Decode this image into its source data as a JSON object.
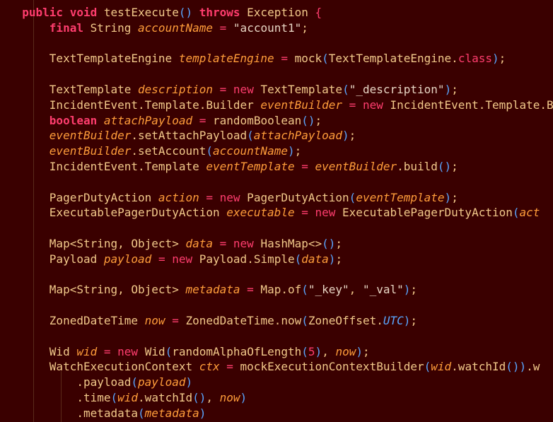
{
  "editor": {
    "lines": [
      [
        [
          "  ",
          "fn"
        ],
        [
          "public",
          "kw"
        ],
        [
          " ",
          "fn"
        ],
        [
          "void",
          "kw"
        ],
        [
          " testExecute",
          "fn"
        ],
        [
          "()",
          "br"
        ],
        [
          " ",
          "fn"
        ],
        [
          "throws",
          "kw"
        ],
        [
          " Exception ",
          "fn"
        ],
        [
          "{",
          "op"
        ]
      ],
      [
        [
          "      ",
          "fn"
        ],
        [
          "final",
          "kw"
        ],
        [
          " String ",
          "ty"
        ],
        [
          "accountName",
          "var"
        ],
        [
          " ",
          "fn"
        ],
        [
          "=",
          "op"
        ],
        [
          " ",
          "fn"
        ],
        [
          "\"account1\"",
          "str"
        ],
        [
          ";",
          "fn"
        ]
      ],
      [],
      [
        [
          "      TextTemplateEngine ",
          "ty"
        ],
        [
          "templateEngine",
          "var"
        ],
        [
          " ",
          "fn"
        ],
        [
          "=",
          "op"
        ],
        [
          " mock",
          "fn"
        ],
        [
          "(",
          "br"
        ],
        [
          "TextTemplateEngine.",
          "ty"
        ],
        [
          "class",
          "op"
        ],
        [
          ")",
          "br"
        ],
        [
          ";",
          "fn"
        ]
      ],
      [],
      [
        [
          "      TextTemplate ",
          "ty"
        ],
        [
          "description",
          "var"
        ],
        [
          " ",
          "fn"
        ],
        [
          "=",
          "op"
        ],
        [
          " ",
          "fn"
        ],
        [
          "new",
          "op"
        ],
        [
          " TextTemplate",
          "ty"
        ],
        [
          "(",
          "br"
        ],
        [
          "\"_description\"",
          "str"
        ],
        [
          ")",
          "br"
        ],
        [
          ";",
          "fn"
        ]
      ],
      [
        [
          "      IncidentEvent.Template.Builder ",
          "ty"
        ],
        [
          "eventBuilder",
          "var"
        ],
        [
          " ",
          "fn"
        ],
        [
          "=",
          "op"
        ],
        [
          " ",
          "fn"
        ],
        [
          "new",
          "op"
        ],
        [
          " IncidentEvent.Template.Builder(",
          "ty"
        ]
      ],
      [
        [
          "      ",
          "fn"
        ],
        [
          "boolean",
          "kw"
        ],
        [
          " ",
          "fn"
        ],
        [
          "attachPayload",
          "var"
        ],
        [
          " ",
          "fn"
        ],
        [
          "=",
          "op"
        ],
        [
          " randomBoolean",
          "fn"
        ],
        [
          "()",
          "br"
        ],
        [
          ";",
          "fn"
        ]
      ],
      [
        [
          "      ",
          "fn"
        ],
        [
          "eventBuilder",
          "var"
        ],
        [
          ".setAttachPayload",
          "fn"
        ],
        [
          "(",
          "br"
        ],
        [
          "attachPayload",
          "var"
        ],
        [
          ")",
          "br"
        ],
        [
          ";",
          "fn"
        ]
      ],
      [
        [
          "      ",
          "fn"
        ],
        [
          "eventBuilder",
          "var"
        ],
        [
          ".setAccount",
          "fn"
        ],
        [
          "(",
          "br"
        ],
        [
          "accountName",
          "var"
        ],
        [
          ")",
          "br"
        ],
        [
          ";",
          "fn"
        ]
      ],
      [
        [
          "      IncidentEvent.Template ",
          "ty"
        ],
        [
          "eventTemplate",
          "var"
        ],
        [
          " ",
          "fn"
        ],
        [
          "=",
          "op"
        ],
        [
          " ",
          "fn"
        ],
        [
          "eventBuilder",
          "var"
        ],
        [
          ".build",
          "fn"
        ],
        [
          "()",
          "br"
        ],
        [
          ";",
          "fn"
        ]
      ],
      [],
      [
        [
          "      PagerDutyAction ",
          "ty"
        ],
        [
          "action",
          "var"
        ],
        [
          " ",
          "fn"
        ],
        [
          "=",
          "op"
        ],
        [
          " ",
          "fn"
        ],
        [
          "new",
          "op"
        ],
        [
          " PagerDutyAction",
          "ty"
        ],
        [
          "(",
          "br"
        ],
        [
          "eventTemplate",
          "var"
        ],
        [
          ")",
          "br"
        ],
        [
          ";",
          "fn"
        ]
      ],
      [
        [
          "      ExecutablePagerDutyAction ",
          "ty"
        ],
        [
          "executable",
          "var"
        ],
        [
          " ",
          "fn"
        ],
        [
          "=",
          "op"
        ],
        [
          " ",
          "fn"
        ],
        [
          "new",
          "op"
        ],
        [
          " ExecutablePagerDutyAction",
          "ty"
        ],
        [
          "(",
          "br"
        ],
        [
          "act",
          "var"
        ]
      ],
      [],
      [
        [
          "      Map<String, Object> ",
          "ty"
        ],
        [
          "data",
          "var"
        ],
        [
          " ",
          "fn"
        ],
        [
          "=",
          "op"
        ],
        [
          " ",
          "fn"
        ],
        [
          "new",
          "op"
        ],
        [
          " HashMap<>",
          "ty"
        ],
        [
          "()",
          "br"
        ],
        [
          ";",
          "fn"
        ]
      ],
      [
        [
          "      Payload ",
          "ty"
        ],
        [
          "payload",
          "var"
        ],
        [
          " ",
          "fn"
        ],
        [
          "=",
          "op"
        ],
        [
          " ",
          "fn"
        ],
        [
          "new",
          "op"
        ],
        [
          " Payload.Simple",
          "ty"
        ],
        [
          "(",
          "br"
        ],
        [
          "data",
          "var"
        ],
        [
          ")",
          "br"
        ],
        [
          ";",
          "fn"
        ]
      ],
      [],
      [
        [
          "      Map<String, Object> ",
          "ty"
        ],
        [
          "metadata",
          "var"
        ],
        [
          " ",
          "fn"
        ],
        [
          "=",
          "op"
        ],
        [
          " Map.of",
          "fn"
        ],
        [
          "(",
          "br"
        ],
        [
          "\"_key\"",
          "str"
        ],
        [
          ", ",
          "fn"
        ],
        [
          "\"_val\"",
          "str"
        ],
        [
          ")",
          "br"
        ],
        [
          ";",
          "fn"
        ]
      ],
      [],
      [
        [
          "      ZonedDateTime ",
          "ty"
        ],
        [
          "now",
          "var"
        ],
        [
          " ",
          "fn"
        ],
        [
          "=",
          "op"
        ],
        [
          " ZonedDateTime.now",
          "fn"
        ],
        [
          "(",
          "br"
        ],
        [
          "ZoneOffset.",
          "ty"
        ],
        [
          "UTC",
          "ital"
        ],
        [
          ")",
          "br"
        ],
        [
          ";",
          "fn"
        ]
      ],
      [],
      [
        [
          "      Wid ",
          "ty"
        ],
        [
          "wid",
          "var"
        ],
        [
          " ",
          "fn"
        ],
        [
          "=",
          "op"
        ],
        [
          " ",
          "fn"
        ],
        [
          "new",
          "op"
        ],
        [
          " Wid",
          "ty"
        ],
        [
          "(",
          "br"
        ],
        [
          "randomAlphaOfLength",
          "fn"
        ],
        [
          "(",
          "br"
        ],
        [
          "5",
          "op"
        ],
        [
          ")",
          "br"
        ],
        [
          ", ",
          "fn"
        ],
        [
          "now",
          "var"
        ],
        [
          ")",
          "br"
        ],
        [
          ";",
          "fn"
        ]
      ],
      [
        [
          "      WatchExecutionContext ",
          "ty"
        ],
        [
          "ctx",
          "var"
        ],
        [
          " ",
          "fn"
        ],
        [
          "=",
          "op"
        ],
        [
          " mockExecutionContextBuilder",
          "fn"
        ],
        [
          "(",
          "br"
        ],
        [
          "wid",
          "var"
        ],
        [
          ".watchId",
          "fn"
        ],
        [
          "())",
          "br"
        ],
        [
          ".w",
          "fn"
        ]
      ],
      [
        [
          "          .payload",
          "fn"
        ],
        [
          "(",
          "br"
        ],
        [
          "payload",
          "var"
        ],
        [
          ")",
          "br"
        ]
      ],
      [
        [
          "          .time",
          "fn"
        ],
        [
          "(",
          "br"
        ],
        [
          "wid",
          "var"
        ],
        [
          ".watchId",
          "fn"
        ],
        [
          "()",
          "br"
        ],
        [
          ", ",
          "fn"
        ],
        [
          "now",
          "var"
        ],
        [
          ")",
          "br"
        ]
      ],
      [
        [
          "          .metadata",
          "fn"
        ],
        [
          "(",
          "br"
        ],
        [
          "metadata",
          "var"
        ],
        [
          ")",
          "br"
        ]
      ]
    ]
  }
}
